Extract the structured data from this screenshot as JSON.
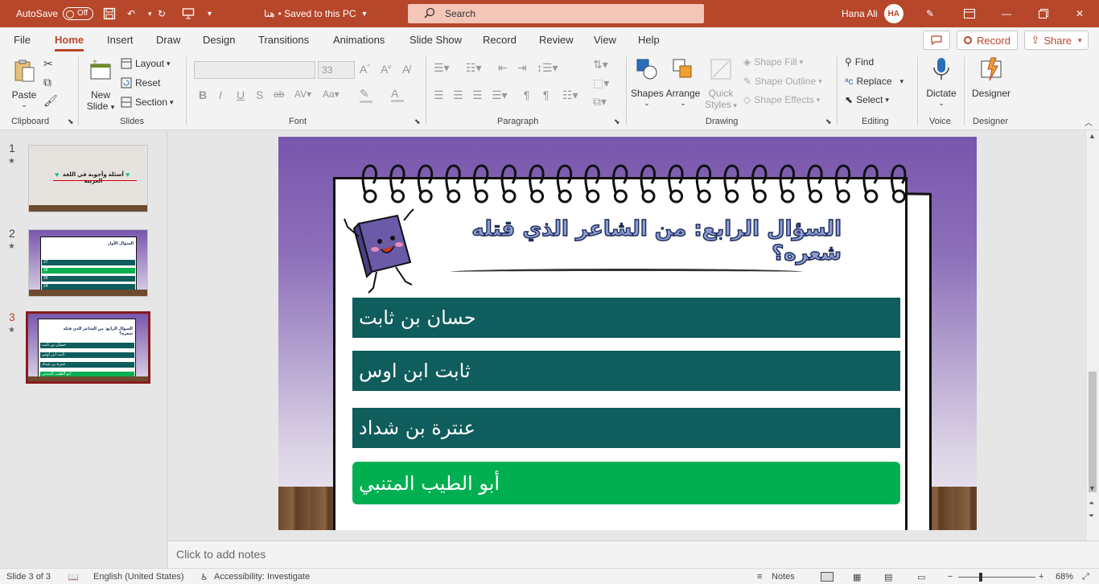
{
  "titlebar": {
    "autosave_label": "AutoSave",
    "autosave_state": "Off",
    "doc_title": "هنا",
    "save_status": "• Saved to this PC",
    "search_placeholder": "Search",
    "user_name": "Hana Ali",
    "user_initials": "HA"
  },
  "menu": {
    "tabs": [
      "File",
      "Home",
      "Insert",
      "Draw",
      "Design",
      "Transitions",
      "Animations",
      "Slide Show",
      "Record",
      "Review",
      "View",
      "Help"
    ],
    "active_tab": "Home",
    "record_label": "Record",
    "share_label": "Share"
  },
  "ribbon": {
    "clipboard": {
      "paste": "Paste",
      "group": "Clipboard"
    },
    "slides": {
      "new_slide": "New",
      "new_slide2": "Slide",
      "layout": "Layout",
      "reset": "Reset",
      "section": "Section",
      "group": "Slides"
    },
    "font": {
      "size": "33",
      "group": "Font",
      "bold": "B",
      "italic": "I",
      "underline": "U",
      "shadow": "S",
      "strike": "ab"
    },
    "paragraph": {
      "group": "Paragraph"
    },
    "drawing": {
      "shapes": "Shapes",
      "arrange": "Arrange",
      "quick_styles": "Quick",
      "quick_styles2": "Styles",
      "shape_fill": "Shape Fill",
      "shape_outline": "Shape Outline",
      "shape_effects": "Shape Effects",
      "group": "Drawing"
    },
    "editing": {
      "find": "Find",
      "replace": "Replace",
      "select": "Select",
      "group": "Editing"
    },
    "voice": {
      "dictate": "Dictate",
      "group": "Voice"
    },
    "designer": {
      "designer": "Designer",
      "group": "Designer"
    }
  },
  "slides_panel": {
    "items": [
      {
        "number": "1",
        "title": "أسئلة وأجوبة في اللغة العربية"
      },
      {
        "number": "2",
        "title": "السؤال الأول",
        "rows": [
          "27",
          "28",
          "26",
          "24"
        ]
      },
      {
        "number": "3",
        "title": "السؤال الرابع: من الشاعر الذي قتله شعره؟",
        "rows": [
          "حسان بن ثابت",
          "ثابت ابن اوس",
          "عنترة بن شداد",
          "أبو الطيب المتنبي"
        ]
      }
    ],
    "active": "3"
  },
  "slide": {
    "question": "السؤال الرابع: من الشاعر الذي قتله شعره؟",
    "answers": [
      "حسان بن ثابت",
      "ثابت ابن اوس",
      "عنترة بن شداد",
      "أبو الطيب المتنبي"
    ],
    "correct_index": 3,
    "colors": {
      "answer_bg": "#0f5d5c",
      "correct_bg": "#00b050",
      "accent": "#b7472a"
    }
  },
  "notes_placeholder": "Click to add notes",
  "status": {
    "slide_pos": "Slide 3 of 3",
    "language": "English (United States)",
    "accessibility": "Accessibility: Investigate",
    "notes": "Notes",
    "zoom": "68%"
  }
}
